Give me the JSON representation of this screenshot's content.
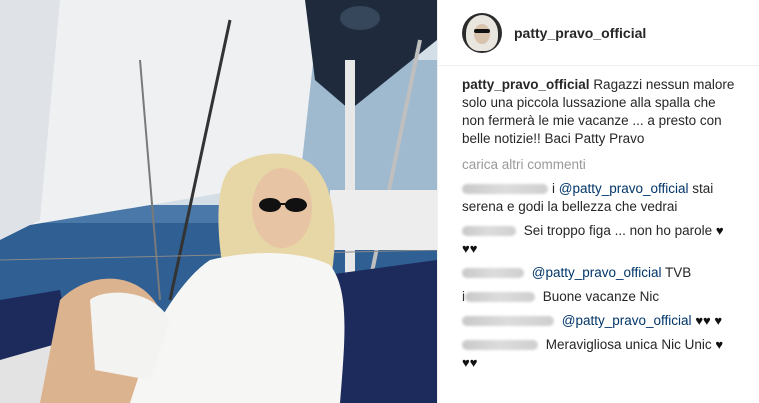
{
  "post": {
    "username": "patty_pravo_official",
    "caption_text": "Ragazzi nessun malore solo una piccola lussazione alla spalla che non fermerà le mie vacanze ... a presto con belle notizie!! Baci Patty Pravo"
  },
  "load_more_label": "carica altri commenti",
  "comments": [
    {
      "prefix": "i",
      "mention": "@patty_pravo_official",
      "text": " stai serena e godi la bellezza che vedrai",
      "hearts": ""
    },
    {
      "prefix": "",
      "mention": "",
      "text": "Sei troppo figa ... non ho parole",
      "hearts": "♥ ♥♥"
    },
    {
      "prefix": "",
      "mention": "@patty_pravo_official",
      "text": " TVB",
      "hearts": ""
    },
    {
      "prefix": "i",
      "mention": "",
      "text": "Buone vacanze Nic",
      "hearts": ""
    },
    {
      "prefix": "",
      "mention": "@patty_pravo_official",
      "text": " ",
      "hearts": "♥♥ ♥"
    },
    {
      "prefix": "",
      "mention": "",
      "text": "Meravigliosa unica Nic Unic",
      "hearts": "♥ ♥♥"
    }
  ],
  "colors": {
    "sky": "#c9d7e3",
    "sea": "#2f5f93",
    "sail_dark": "#1f2b3c",
    "mention": "#003569"
  }
}
